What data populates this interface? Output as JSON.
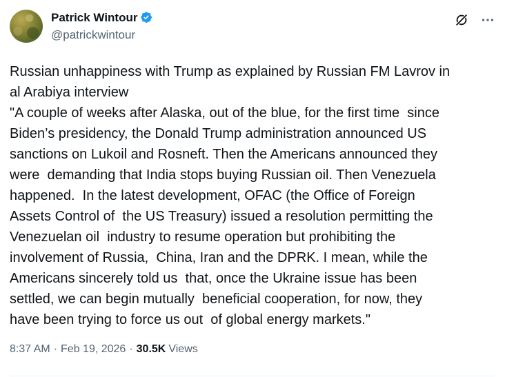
{
  "author": {
    "display_name": "Patrick Wintour",
    "handle": "@patrickwintour",
    "verified": true
  },
  "tweet": {
    "text": "Russian unhappiness with Trump as explained by Russian FM Lavrov in\nal Arabiya interview\n\"A couple of weeks after Alaska, out of the blue, for the first time  since\nBiden’s presidency, the Donald Trump administration announced US\nsanctions on Lukoil and Rosneft. Then the Americans announced they\nwere  demanding that India stops buying Russian oil. Then Venezuela\nhappened.  In the latest development, OFAC (the Office of Foreign\nAssets Control of  the US Treasury) issued a resolution permitting the\nVenezuelan oil  industry to resume operation but prohibiting the\ninvolvement of Russia,  China, Iran and the DPRK. I mean, while the\nAmericans sincerely told us  that, once the Ukraine issue has been\nsettled, we can begin mutually  beneficial cooperation, for now, they\nhave been trying to force us out  of global energy markets.\"",
    "time": "8:37 AM",
    "date": "Feb 19, 2026",
    "separator": "·",
    "views_count": "30.5K",
    "views_label": "Views"
  },
  "icons": {
    "verified": "verified-badge-icon",
    "grok": "grok-icon",
    "more": "more-options-icon"
  },
  "colors": {
    "verified_blue": "#1d9bf0",
    "text_primary": "#0f1419",
    "text_secondary": "#536471"
  }
}
